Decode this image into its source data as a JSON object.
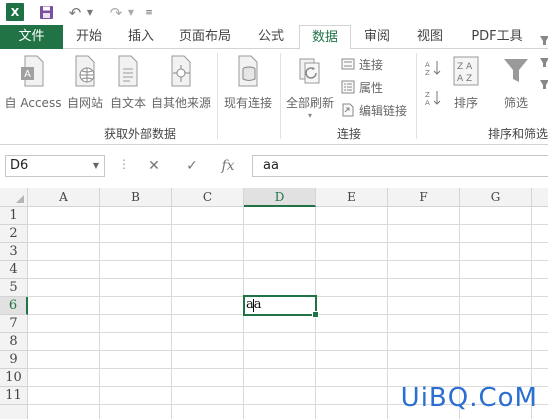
{
  "app": {
    "logo_letter": "X"
  },
  "tabs": [
    "文件",
    "开始",
    "插入",
    "页面布局",
    "公式",
    "数据",
    "审阅",
    "视图",
    "PDF工具"
  ],
  "ribbon": {
    "get_external": {
      "label": "获取外部数据",
      "buttons": [
        "自 Access",
        "自网站",
        "自文本",
        "自其他来源",
        "现有连接"
      ]
    },
    "connections": {
      "label": "连接",
      "refresh_all": "全部刷新",
      "small": [
        "连接",
        "属性",
        "编辑链接"
      ]
    },
    "sort_filter": {
      "label": "排序和筛选",
      "sort": "排序",
      "filter": "筛选"
    },
    "colors": {
      "accent": "#217346"
    }
  },
  "formula_bar": {
    "name_box": "D6",
    "value": "aa"
  },
  "grid": {
    "columns": [
      "A",
      "B",
      "C",
      "D",
      "E",
      "F",
      "G"
    ],
    "rows": [
      "1",
      "2",
      "3",
      "4",
      "5",
      "6",
      "7",
      "8",
      "9",
      "10",
      "11"
    ],
    "selected_column": "D",
    "selected_row": "6",
    "cell_value": "aa"
  },
  "watermark": "UiBQ.CoM"
}
